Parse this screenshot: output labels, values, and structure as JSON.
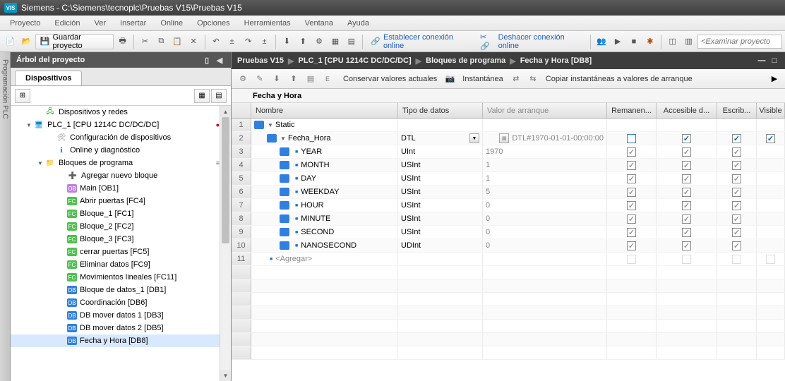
{
  "title": "Siemens  -  C:\\Siemens\\tecnoplc\\Pruebas V15\\Pruebas V15",
  "logo": "VIS",
  "menu": [
    "Proyecto",
    "Edición",
    "Ver",
    "Insertar",
    "Online",
    "Opciones",
    "Herramientas",
    "Ventana",
    "Ayuda"
  ],
  "toolbar": {
    "save_label": "Guardar proyecto",
    "online1": "Establecer conexión online",
    "online2": "Deshacer conexión online",
    "search_ph": "<Examinar proyecto"
  },
  "tree": {
    "header": "Árbol del proyecto",
    "tab": "Dispositivos",
    "items": [
      {
        "indent": 1,
        "icon": "net",
        "toggle": "",
        "label": "Dispositivos y redes"
      },
      {
        "indent": 0,
        "icon": "dev",
        "toggle": "▼",
        "label": "PLC_1 [CPU 1214C DC/DC/DC]",
        "badge": true
      },
      {
        "indent": 2,
        "icon": "cfg",
        "toggle": "",
        "label": "Configuración de dispositivos"
      },
      {
        "indent": 2,
        "icon": "online",
        "toggle": "",
        "label": "Online y diagnóstico"
      },
      {
        "indent": 1,
        "icon": "folder",
        "toggle": "▼",
        "label": "Bloques de programa",
        "menu": true
      },
      {
        "indent": 3,
        "icon": "add",
        "toggle": "",
        "label": "Agregar nuevo bloque"
      },
      {
        "indent": 3,
        "icon": "ob",
        "toggle": "",
        "label": "Main [OB1]"
      },
      {
        "indent": 3,
        "icon": "fc",
        "toggle": "",
        "label": "Abrir puertas [FC4]"
      },
      {
        "indent": 3,
        "icon": "fc",
        "toggle": "",
        "label": "Bloque_1 [FC1]"
      },
      {
        "indent": 3,
        "icon": "fc",
        "toggle": "",
        "label": "Bloque_2 [FC2]"
      },
      {
        "indent": 3,
        "icon": "fc",
        "toggle": "",
        "label": "Bloque_3 [FC3]"
      },
      {
        "indent": 3,
        "icon": "fc",
        "toggle": "",
        "label": "cerrar puertas [FC5]"
      },
      {
        "indent": 3,
        "icon": "fc",
        "toggle": "",
        "label": "Eliminar datos [FC9]"
      },
      {
        "indent": 3,
        "icon": "fc",
        "toggle": "",
        "label": "Movimientos lineales [FC11]"
      },
      {
        "indent": 3,
        "icon": "db",
        "toggle": "",
        "label": "Bloque de datos_1 [DB1]"
      },
      {
        "indent": 3,
        "icon": "db",
        "toggle": "",
        "label": "Coordinación [DB6]"
      },
      {
        "indent": 3,
        "icon": "db",
        "toggle": "",
        "label": "DB mover datos 1 [DB3]"
      },
      {
        "indent": 3,
        "icon": "db",
        "toggle": "",
        "label": "DB mover datos 2 [DB5]"
      },
      {
        "indent": 3,
        "icon": "db",
        "toggle": "",
        "label": "Fecha y Hora [DB8]",
        "selected": true
      }
    ]
  },
  "breadcrumb": [
    "Pruebas V15",
    "PLC_1 [CPU 1214C DC/DC/DC]",
    "Bloques de programa",
    "Fecha y Hora [DB8]"
  ],
  "editor_toolbar": {
    "conserve": "Conservar valores actuales",
    "snapshot": "Instantánea",
    "copy": "Copiar instantáneas a valores de arranque"
  },
  "block_title": "Fecha y Hora",
  "grid": {
    "headers": {
      "name": "Nombre",
      "type": "Tipo de datos",
      "val": "Valor de arranque",
      "ret": "Remanen...",
      "acc": "Accesible d...",
      "wri": "Escrib...",
      "vis": "Visible"
    },
    "rows": [
      {
        "n": "1",
        "indent": 0,
        "toggle": "▼",
        "name": "Static",
        "type": "",
        "val": "",
        "ret": "",
        "acc": "",
        "wri": "",
        "vis": "",
        "isdt": true
      },
      {
        "n": "2",
        "indent": 1,
        "toggle": "▼",
        "name": "Fecha_Hora",
        "type": "DTL",
        "val": "DTL#1970-01-01-00:00:00",
        "ret": false,
        "acc": true,
        "wri": true,
        "vis": true,
        "isdt": true,
        "dd": true,
        "pick": true,
        "retborder": true
      },
      {
        "n": "3",
        "indent": 2,
        "bullet": true,
        "name": "YEAR",
        "type": "UInt",
        "val": "1970",
        "ret": "off",
        "acc": "off",
        "wri": "off",
        "vis": "",
        "isdt": true
      },
      {
        "n": "4",
        "indent": 2,
        "bullet": true,
        "name": "MONTH",
        "type": "USInt",
        "val": "1",
        "ret": "off",
        "acc": "off",
        "wri": "off",
        "vis": "",
        "isdt": true
      },
      {
        "n": "5",
        "indent": 2,
        "bullet": true,
        "name": "DAY",
        "type": "USInt",
        "val": "1",
        "ret": "off",
        "acc": "off",
        "wri": "off",
        "vis": "",
        "isdt": true
      },
      {
        "n": "6",
        "indent": 2,
        "bullet": true,
        "name": "WEEKDAY",
        "type": "USInt",
        "val": "5",
        "ret": "off",
        "acc": "off",
        "wri": "off",
        "vis": "",
        "isdt": true
      },
      {
        "n": "7",
        "indent": 2,
        "bullet": true,
        "name": "HOUR",
        "type": "USInt",
        "val": "0",
        "ret": "off",
        "acc": "off",
        "wri": "off",
        "vis": "",
        "isdt": true
      },
      {
        "n": "8",
        "indent": 2,
        "bullet": true,
        "name": "MINUTE",
        "type": "USInt",
        "val": "0",
        "ret": "off",
        "acc": "off",
        "wri": "off",
        "vis": "",
        "isdt": true
      },
      {
        "n": "9",
        "indent": 2,
        "bullet": true,
        "name": "SECOND",
        "type": "USInt",
        "val": "0",
        "ret": "off",
        "acc": "off",
        "wri": "off",
        "vis": "",
        "isdt": true
      },
      {
        "n": "10",
        "indent": 2,
        "bullet": true,
        "name": "NANOSECOND",
        "type": "UDInt",
        "val": "0",
        "ret": "off",
        "acc": "off",
        "wri": "off",
        "vis": "",
        "isdt": true
      },
      {
        "n": "11",
        "indent": 1,
        "bullet": true,
        "name": "<Agregar>",
        "type": "",
        "val": "",
        "ret": "nb",
        "acc": "nb",
        "wri": "nb",
        "vis": "nb",
        "add": true
      }
    ]
  }
}
